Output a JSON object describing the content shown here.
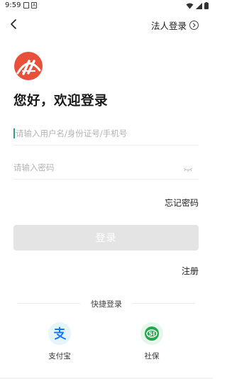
{
  "status_bar": {
    "time": "9:59",
    "left_icons": [
      "image-icon",
      "a-icon"
    ],
    "right_icons": [
      "wifi-icon",
      "signal-icon",
      "battery-icon"
    ]
  },
  "nav": {
    "back_icon": "chevron-left-icon",
    "corp_login_label": "法人登录",
    "corp_login_icon": "circle-arrow-right-icon"
  },
  "brand": {
    "logo_icon": "brand-logo-icon",
    "logo_color": "#e8503a"
  },
  "greeting": "您好，欢迎登录",
  "form": {
    "username_placeholder": "请输入用户名/身份证号/手机号",
    "password_placeholder": "请输入密码",
    "password_toggle_icon": "eye-closed-icon",
    "forgot_label": "忘记密码",
    "login_label": "登录",
    "register_label": "注册",
    "accent_color": "#2a9d8f"
  },
  "quick_login": {
    "label": "快捷登录",
    "items": [
      {
        "label": "支付宝",
        "icon": "alipay-icon",
        "color": "#1677ff"
      },
      {
        "label": "社保",
        "icon": "social-security-icon",
        "color": "#22a84a"
      }
    ]
  }
}
